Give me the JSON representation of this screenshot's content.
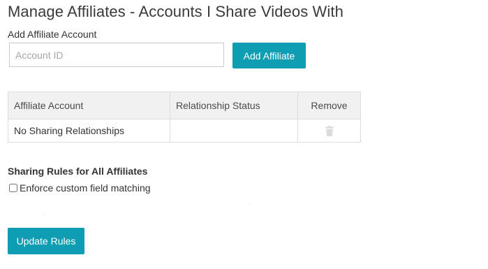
{
  "header": {
    "title": "Manage Affiliates - Accounts I Share Videos With"
  },
  "add_form": {
    "label": "Add Affiliate Account",
    "input_placeholder": "Account ID",
    "input_value": "",
    "button_label": "Add Affiliate"
  },
  "table": {
    "headers": [
      "Affiliate Account",
      "Relationship Status",
      "Remove"
    ],
    "rows": [
      {
        "account": "No Sharing Relationships",
        "status": "",
        "remove_icon": "trash-icon"
      }
    ]
  },
  "rules": {
    "title": "Sharing Rules for All Affiliates",
    "checkbox_label": "Enforce custom field matching",
    "checkbox_checked": false,
    "button_label": "Update Rules"
  },
  "colors": {
    "accent": "#0e9db3",
    "header_bg": "#f1f1f1",
    "border": "#dddddd",
    "icon": "#dcdcdc"
  }
}
